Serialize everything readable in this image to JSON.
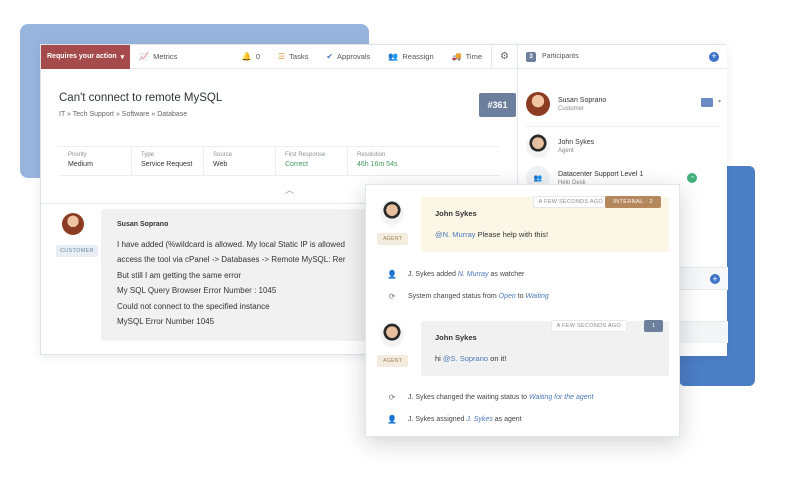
{
  "toolbar": {
    "requires_action": "Requires your action",
    "metrics": "Metrics",
    "notif_count": "0",
    "tasks": "Tasks",
    "approvals": "Approvals",
    "reassign": "Reassign",
    "time": "Time"
  },
  "ticket": {
    "title": "Can't connect to remote MySQL",
    "breadcrumb": "IT  »  Tech Support  »  Software  »  Database",
    "number": "#361",
    "meta": [
      {
        "label": "Priority",
        "value": "Medium"
      },
      {
        "label": "Type",
        "value": "Service Request"
      },
      {
        "label": "Source",
        "value": "Web"
      },
      {
        "label": "First Response",
        "value": "Correct"
      },
      {
        "label": "Resolution",
        "value": "46h 16m 54s"
      }
    ]
  },
  "message": {
    "author": "Susan Soprano",
    "role_tag": "CUSTOMER",
    "lines": [
      "I have added (%wildcard is allowed. My local Static IP is allowed",
      "access the tool via cPanel -> Databases -> Remote MySQL: Rer",
      "But still I am getting the same error",
      "My SQL Query Browser Error Number : 1045",
      "Could not connect to the specified instance",
      "MySQL Error Number 1045"
    ]
  },
  "participants": {
    "header": "Participants",
    "count": "3",
    "people": [
      {
        "name": "Susan Soprano",
        "role": "Customer"
      },
      {
        "name": "John Sykes",
        "role": "Agent"
      },
      {
        "name": "Datacenter Support Level 1",
        "role": "Help Desk"
      }
    ]
  },
  "activity": {
    "note1": {
      "author": "John Sykes",
      "timestamp": "A FEW SECONDS AGO",
      "badge": "INTERNAL  ·  2",
      "mention": "@N. Murray",
      "text": " Please help with this!",
      "tag": "AGENT"
    },
    "event1": {
      "actor": "J. Sykes",
      "verb": " added ",
      "target": "N. Murray",
      "rest": " as watcher"
    },
    "event2": {
      "prefix": "System changed status from ",
      "from": "Open",
      "mid": " to ",
      "to": "Waiting"
    },
    "note2": {
      "author": "John Sykes",
      "timestamp": "A FEW SECONDS AGO",
      "badge": "1",
      "pre": "hi ",
      "mention": "@S. Soprano",
      "text": " on it!",
      "tag": "AGENT"
    },
    "event3": {
      "actor": "J. Sykes",
      "verb": " changed the waiting status to ",
      "target": "Waiting for the agent"
    },
    "event4": {
      "actor": "J. Sykes",
      "verb": " assigned ",
      "target": "J. Sykes",
      "rest": " as agent"
    }
  },
  "colors": {
    "accent_red": "#a54b4b",
    "accent_blue": "#3d73c8",
    "ticket_badge": "#6c7f9c",
    "success_green": "#3f9b5e",
    "internal_badge": "#b4875d"
  },
  "icons": [
    "chevron-down-icon",
    "metrics-icon",
    "bell-icon",
    "tasks-icon",
    "approvals-icon",
    "reassign-icon",
    "time-icon",
    "gear-icon",
    "plus-icon",
    "vcard-icon",
    "clock-icon",
    "add-user-icon",
    "refresh-icon",
    "assign-icon"
  ]
}
